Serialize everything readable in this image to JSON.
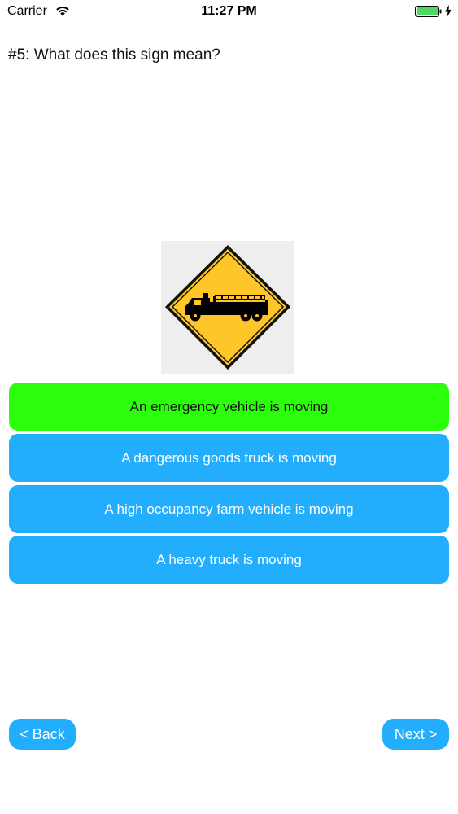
{
  "status_bar": {
    "carrier": "Carrier",
    "time": "11:27 PM",
    "icons": [
      "wifi-icon",
      "battery-icon",
      "charging-bolt-icon"
    ],
    "battery_color": "#4cd964"
  },
  "question": {
    "text": "#5: What does this sign mean?"
  },
  "sign": {
    "icon": "fire-truck-warning-sign",
    "sign_color": "#ffc62a",
    "background_color": "#eeeeee"
  },
  "answers": [
    {
      "label": "An emergency vehicle is moving",
      "state": "correct"
    },
    {
      "label": "A dangerous goods truck is moving",
      "state": "normal"
    },
    {
      "label": "A high occupancy farm vehicle is moving",
      "state": "normal"
    },
    {
      "label": "A heavy truck is moving",
      "state": "normal"
    }
  ],
  "colors": {
    "correct": "#2cff0b",
    "button": "#22aefc"
  },
  "navigation": {
    "back_label": "< Back",
    "next_label": "Next >"
  }
}
